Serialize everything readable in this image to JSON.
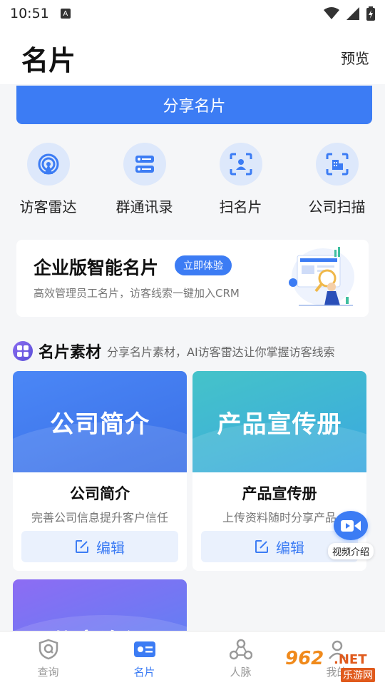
{
  "status_bar": {
    "time": "10:51",
    "notification_letter": "A"
  },
  "header": {
    "title": "名片",
    "preview_label": "预览"
  },
  "share_button": {
    "label": "分享名片"
  },
  "quick_actions": [
    {
      "label": "访客雷达",
      "icon": "radar-icon"
    },
    {
      "label": "群通讯录",
      "icon": "contact-list-icon"
    },
    {
      "label": "扫名片",
      "icon": "scan-card-icon"
    },
    {
      "label": "公司扫描",
      "icon": "company-scan-icon"
    }
  ],
  "promo": {
    "title": "企业版智能名片",
    "badge": "立即体验",
    "subtitle": "高效管理员工名片，访客线索一键加入CRM"
  },
  "materials_section": {
    "title": "名片素材",
    "description": "分享名片素材，AI访客雷达让你掌握访客线索"
  },
  "material_cards": [
    {
      "banner_text": "公司简介",
      "title": "公司简介",
      "description": "完善公司信息提升客户信任",
      "edit_label": "编辑"
    },
    {
      "banner_text": "产品宣传册",
      "title": "产品宣传册",
      "description": "上传资料随时分享产品",
      "edit_label": "编辑"
    },
    {
      "banner_text": "分享资讯"
    }
  ],
  "video_float": {
    "label": "视频介绍"
  },
  "tabbar": [
    {
      "label": "查询",
      "icon": "shield-search-icon",
      "active": false
    },
    {
      "label": "名片",
      "icon": "card-icon",
      "active": true
    },
    {
      "label": "人脉",
      "icon": "network-icon",
      "active": false
    },
    {
      "label": "我的",
      "icon": "person-icon",
      "active": false
    }
  ],
  "watermark": {
    "number": "962",
    "suffix": ".NET",
    "site": "乐游网"
  },
  "colors": {
    "primary": "#3c7cf4",
    "light_blue": "#dde8fb",
    "teal": "#45c3c9",
    "purple": "#8d6cf3"
  }
}
